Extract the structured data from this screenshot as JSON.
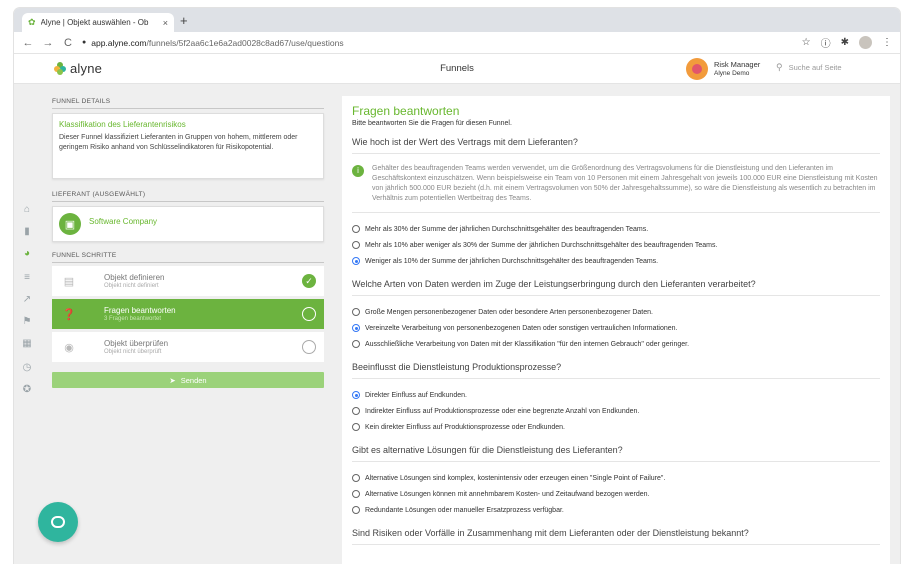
{
  "browser": {
    "tab_title": "Alyne | Objekt auswählen - Ob",
    "tab_close": "×",
    "new_tab": "+",
    "url_host": "app.alyne.com",
    "url_path": "/funnels/5f2aa6c1e6a2ad0028c8ad67/use/questions",
    "back": "←",
    "forward": "→",
    "reload": "C",
    "lock": "🔒",
    "star": "☆",
    "menu": "⋮"
  },
  "header": {
    "logo_text": "alyne",
    "title": "Funnels",
    "user_role": "Risk Manager",
    "user_org": "Alyne Demo",
    "search_placeholder": "Suche auf Seite"
  },
  "funnel": {
    "details_label": "FUNNEL DETAILS",
    "details_title": "Klassifikation des Lieferantenrisikos",
    "details_desc": "Dieser Funnel klassifiziert Lieferanten in Gruppen von hohem, mittlerem oder geringem Risiko anhand von Schlüsselindikatoren für Risikopotential.",
    "supplier_label": "LIEFERANT (AUSGEWÄHLT)",
    "supplier_name": "Software Company",
    "steps_label": "FUNNEL SCHRITTE",
    "steps": [
      {
        "title": "Objekt definieren",
        "sub": "Objekt nicht definiert",
        "state": "done"
      },
      {
        "title": "Fragen beantworten",
        "sub": "3 Fragen beantwortet",
        "state": "active"
      },
      {
        "title": "Objekt überprüfen",
        "sub": "Objekt nicht überprüft",
        "state": "todo"
      }
    ],
    "send_label": "Senden"
  },
  "main": {
    "title": "Fragen beantworten",
    "subtitle": "Bitte beantworten Sie die Fragen für diesen Funnel.",
    "questions": [
      {
        "text": "Wie hoch ist der Wert des Vertrags mit dem Lieferanten?",
        "info": "Gehälter des beauftragenden Teams werden verwendet, um die Größenordnung des Vertragsvolumens für die Dienstleistung und den Lieferanten im Geschäftskontext einzuschätzen. Wenn beispielsweise ein Team von 10 Personen mit einem Jahresgehalt von jeweils 100.000 EUR eine Dienstleistung mit Kosten von jährlich 500.000 EUR bezieht (d.h. mit einem Vertragsvolumen von 50% der Jahresgehaltssumme), so wäre die Dienstleistung als wesentlich zu betrachten im Verhältnis zum potentiellen Wertbeitrag des Teams.",
        "options": [
          {
            "label": "Mehr als 30% der Summe der jährlichen Durchschnittsgehälter des beauftragenden Teams.",
            "checked": false
          },
          {
            "label": "Mehr als 10% aber weniger als 30% der Summe der jährlichen Durchschnittsgehälter des beauftragenden Teams.",
            "checked": false
          },
          {
            "label": "Weniger als 10% der Summe der jährlichen Durchschnittsgehälter des beauftragenden Teams.",
            "checked": true
          }
        ]
      },
      {
        "text": "Welche Arten von Daten werden im Zuge der Leistungserbringung durch den Lieferanten verarbeitet?",
        "options": [
          {
            "label": "Große Mengen personenbezogener Daten oder besondere Arten personenbezogener Daten.",
            "checked": false
          },
          {
            "label": "Vereinzelte Verarbeitung von personenbezogenen Daten oder sonstigen vertraulichen Informationen.",
            "checked": true
          },
          {
            "label": "Ausschließliche Verarbeitung von Daten mit der Klassifikation \"für den internen Gebrauch\" oder geringer.",
            "checked": false
          }
        ]
      },
      {
        "text": "Beeinflusst die Dienstleistung Produktionsprozesse?",
        "options": [
          {
            "label": "Direkter Einfluss auf Endkunden.",
            "checked": true
          },
          {
            "label": "Indirekter Einfluss auf Produktionsprozesse oder eine begrenzte Anzahl von Endkunden.",
            "checked": false
          },
          {
            "label": "Kein direkter Einfluss auf Produktionsprozesse oder Endkunden.",
            "checked": false
          }
        ]
      },
      {
        "text": "Gibt es alternative Lösungen für die Dienstleistung des Lieferanten?",
        "options": [
          {
            "label": "Alternative Lösungen sind komplex, kostenintensiv oder erzeugen einen \"Single Point of Failure\".",
            "checked": false
          },
          {
            "label": "Alternative Lösungen können mit annehmbarem Kosten- und Zeitaufwand bezogen werden.",
            "checked": false
          },
          {
            "label": "Redundante Lösungen oder manueller Ersatzprozess verfügbar.",
            "checked": false
          }
        ]
      },
      {
        "text": "Sind Risiken oder Vorfälle in Zusammenhang mit dem Lieferanten oder der Dienstleistung bekannt?",
        "options": []
      }
    ]
  },
  "colors": {
    "accent": "#6cb33f",
    "chat": "#2fb59e",
    "radio": "#3478f6"
  }
}
